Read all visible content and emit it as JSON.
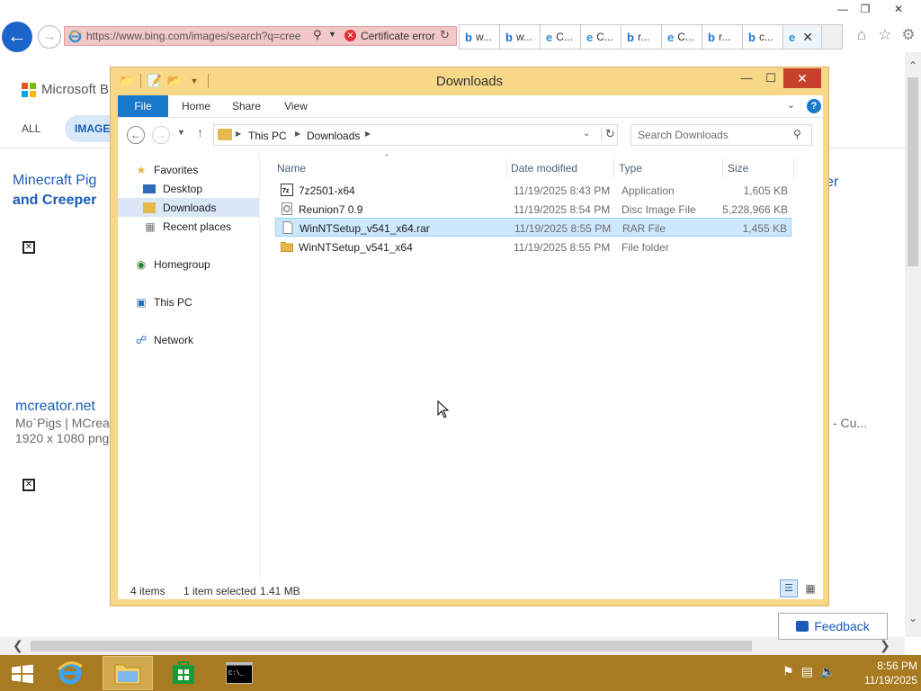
{
  "browser": {
    "address": "https://www.bing.com/images/search?q=cree",
    "cert_error": "Certificate error",
    "tabs": [
      {
        "label": "w...",
        "favicon": "bing-icon",
        "color": "#1f6fd1"
      },
      {
        "label": "w...",
        "favicon": "bing-icon",
        "color": "#1f6fd1"
      },
      {
        "label": "C...",
        "favicon": "ie-icon",
        "color": "#2e8fd6"
      },
      {
        "label": "C...",
        "favicon": "ie-icon",
        "color": "#2e8fd6"
      },
      {
        "label": "r...",
        "favicon": "bing-icon",
        "color": "#1f6fd1"
      },
      {
        "label": "C...",
        "favicon": "ie-icon",
        "color": "#2e8fd6"
      },
      {
        "label": "r...",
        "favicon": "bing-icon",
        "color": "#1f6fd1"
      },
      {
        "label": "c...",
        "favicon": "bing-icon",
        "color": "#1f6fd1"
      }
    ],
    "active_tab_close": "✕"
  },
  "bing": {
    "brand": "Microsoft Bi",
    "tab_all": "ALL",
    "tab_images": "IMAGES",
    "result1_title_line1": "Minecraft Pig",
    "result1_title_line2": "and Creeper",
    "right_title_fragment": "er",
    "result2_title": "mcreator.net",
    "result2_desc": "Mo`Pigs | MCrea",
    "result2_size": "1920 x 1080 png",
    "right_desc_fragment": "- Cu..."
  },
  "feedback_label": "Feedback",
  "explorer": {
    "title": "Downloads",
    "ribbon_tabs": [
      "File",
      "Home",
      "Share",
      "View"
    ],
    "breadcrumb": [
      "This PC",
      "Downloads"
    ],
    "search_placeholder": "Search Downloads",
    "nav": {
      "favorites": "Favorites",
      "desktop": "Desktop",
      "downloads": "Downloads",
      "recent": "Recent places",
      "homegroup": "Homegroup",
      "this_pc": "This PC",
      "network": "Network"
    },
    "columns": {
      "name": "Name",
      "date": "Date modified",
      "type": "Type",
      "size": "Size"
    },
    "files": [
      {
        "name": "7z2501-x64",
        "date": "11/19/2025 8:43 PM",
        "type": "Application",
        "size": "1,605 KB",
        "icon": "7z-app-icon"
      },
      {
        "name": "Reunion7 0.9",
        "date": "11/19/2025 8:54 PM",
        "type": "Disc Image File",
        "size": "5,228,966 KB",
        "icon": "disc-image-icon"
      },
      {
        "name": "WinNTSetup_v541_x64.rar",
        "date": "11/19/2025 8:55 PM",
        "type": "RAR File",
        "size": "1,455 KB",
        "icon": "file-icon",
        "selected": true
      },
      {
        "name": "WinNTSetup_v541_x64",
        "date": "11/19/2025 8:55 PM",
        "type": "File folder",
        "size": "",
        "icon": "folder-icon"
      }
    ],
    "status": {
      "count": "4 items",
      "selected": "1 item selected",
      "size": "1.41 MB"
    }
  },
  "taskbar": {
    "time": "8:56 PM",
    "date": "11/19/2025"
  },
  "colors": {
    "explorer_frame": "#f7d889",
    "taskbar": "#a87a21",
    "ribbon_file": "#1979ca",
    "close_button": "#c7402a",
    "selection": "#cce8ff",
    "link": "#1a5cb8"
  }
}
